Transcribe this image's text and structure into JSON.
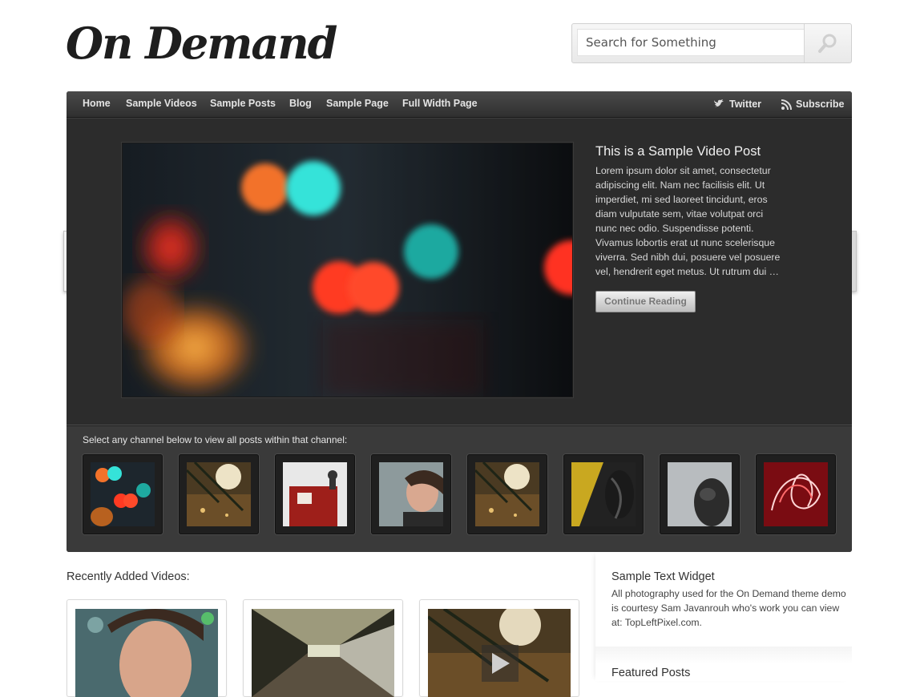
{
  "header": {
    "logo": "On Demand",
    "search_placeholder": "Search for Something"
  },
  "nav": {
    "items": [
      "Home",
      "Sample Videos",
      "Sample Posts",
      "Blog",
      "Sample Page",
      "Full Width Page"
    ],
    "twitter": "Twitter",
    "subscribe": "Subscribe"
  },
  "featured": {
    "title": "This is a Sample Video Post",
    "excerpt": "Lorem ipsum dolor sit amet, consectetur adipiscing elit. Nam nec facilisis elit. Ut imperdiet, mi sed laoreet tincidunt, eros diam vulputate sem, vitae volutpat orci nunc nec odio. Suspendisse potenti. Vivamus lobortis erat ut nunc scelerisque viverra. Sed nibh dui, posuere vel posuere vel, hendrerit eget metus. Ut rutrum dui …",
    "button": "Continue Reading"
  },
  "channels": {
    "label": "Select any channel below to view all posts within that channel:"
  },
  "recent": {
    "label": "Recently Added Videos:"
  },
  "sidebar": {
    "widget_title": "Sample Text Widget",
    "widget_text": "All photography used for the On Demand theme demo is courtesy Sam Javanrouh who's work you can view at: TopLeftPixel.com.",
    "featured_title": "Featured Posts"
  },
  "colors": {
    "panel_bg": "#2c2c2c",
    "nav_text": "#e4e4e4",
    "page_bg": "#ffffff"
  }
}
